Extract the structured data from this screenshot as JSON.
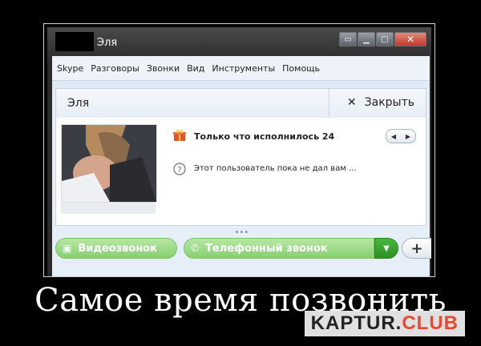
{
  "window": {
    "title": "Эля",
    "controls": [
      "restore-icon",
      "minimize-icon",
      "maximize-icon",
      "close-icon"
    ]
  },
  "menu": [
    "Skype",
    "Разговоры",
    "Звонки",
    "Вид",
    "Инструменты",
    "Помощь"
  ],
  "contact": {
    "name": "Эля",
    "close_label": "Закрыть",
    "mood_text": "Только что исполнилось 24",
    "status_text": "Этот пользователь пока не дал вам ..."
  },
  "actions": {
    "video_label": "Видеозвонок",
    "phone_label": "Телефонный звонок",
    "add_label": "+"
  },
  "caption": "Самое время позвонить",
  "watermark": {
    "part1": "KAPTUR.",
    "part2": "CLUB"
  },
  "colors": {
    "call_green": "#86d070",
    "dropdown_green": "#2d8f25",
    "close_red": "#c0392b"
  }
}
